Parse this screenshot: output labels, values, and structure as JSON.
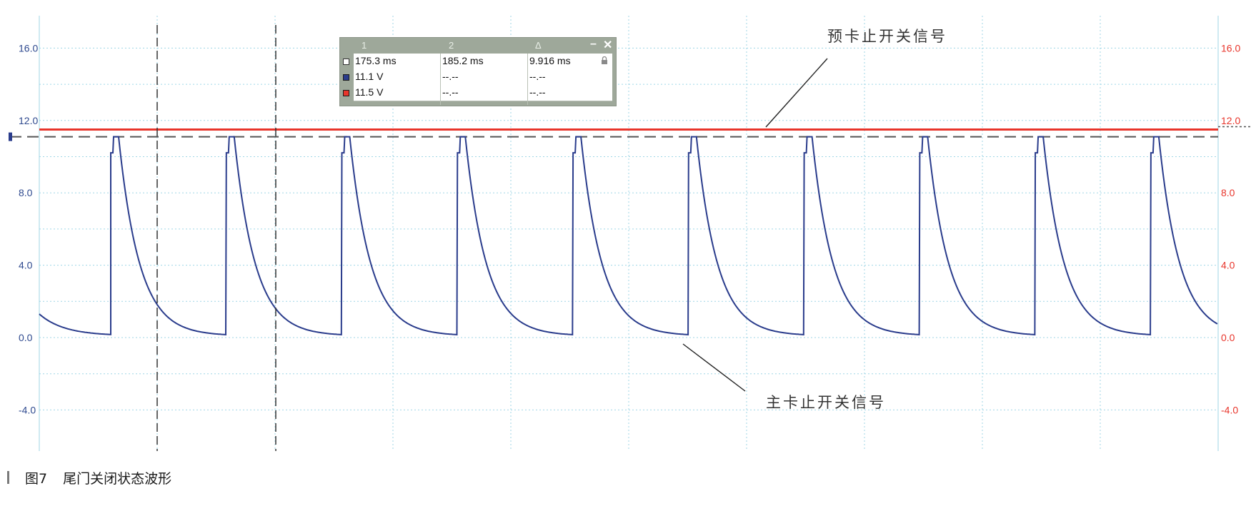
{
  "caption": {
    "figure": "图7",
    "title": "尾门关闭状态波形"
  },
  "annotations": {
    "top_signal": "预卡止开关信号",
    "bottom_signal": "主卡止开关信号"
  },
  "measurement_panel": {
    "headers": [
      "1",
      "2",
      "Δ"
    ],
    "rows": [
      {
        "c1": "175.3 ms",
        "c2": "185.2 ms",
        "c3": "9.916 ms",
        "swatch": "#ffffff"
      },
      {
        "c1": "11.1 V",
        "c2": "--.--",
        "c3": "--.--",
        "swatch": "#2a3c8c"
      },
      {
        "c1": "11.5 V",
        "c2": "--.--",
        "c3": "--.--",
        "swatch": "#e8352b"
      }
    ],
    "controls": {
      "minimize": "–",
      "close": "✕"
    },
    "icons": [
      "padlock-icon"
    ]
  },
  "colors": {
    "grid": "#9fd6e6",
    "left_axis": "#2f4a8f",
    "right_axis": "#e8352b",
    "main_signal": "#2a3c8c",
    "pre_signal": "#e8352b"
  },
  "chart_data": {
    "type": "line",
    "ylim": [
      -6.0,
      17.5
    ],
    "yticks_left": [
      "16.0",
      "12.0",
      "8.0",
      "4.0",
      "0.0",
      "-4.0"
    ],
    "yticks_right": [
      "16.0",
      "12.0",
      "8.0",
      "4.0",
      "0.0",
      "-4.0"
    ],
    "grid": true,
    "series": [
      {
        "name": "主卡止开关信号",
        "color": "#2a3c8c",
        "pulse_count": 10,
        "high_level": 11.1,
        "low_level": 0.1,
        "value_at_left_edge": 1.3,
        "value_at_right_edge": 1.0
      },
      {
        "name": "预卡止开关信号",
        "color": "#e8352b",
        "level": 11.5
      }
    ],
    "reference_level": 11.1,
    "cursors": {
      "cursor1_ms": 175.3,
      "cursor2_ms": 185.2,
      "delta_ms": 9.916
    }
  }
}
